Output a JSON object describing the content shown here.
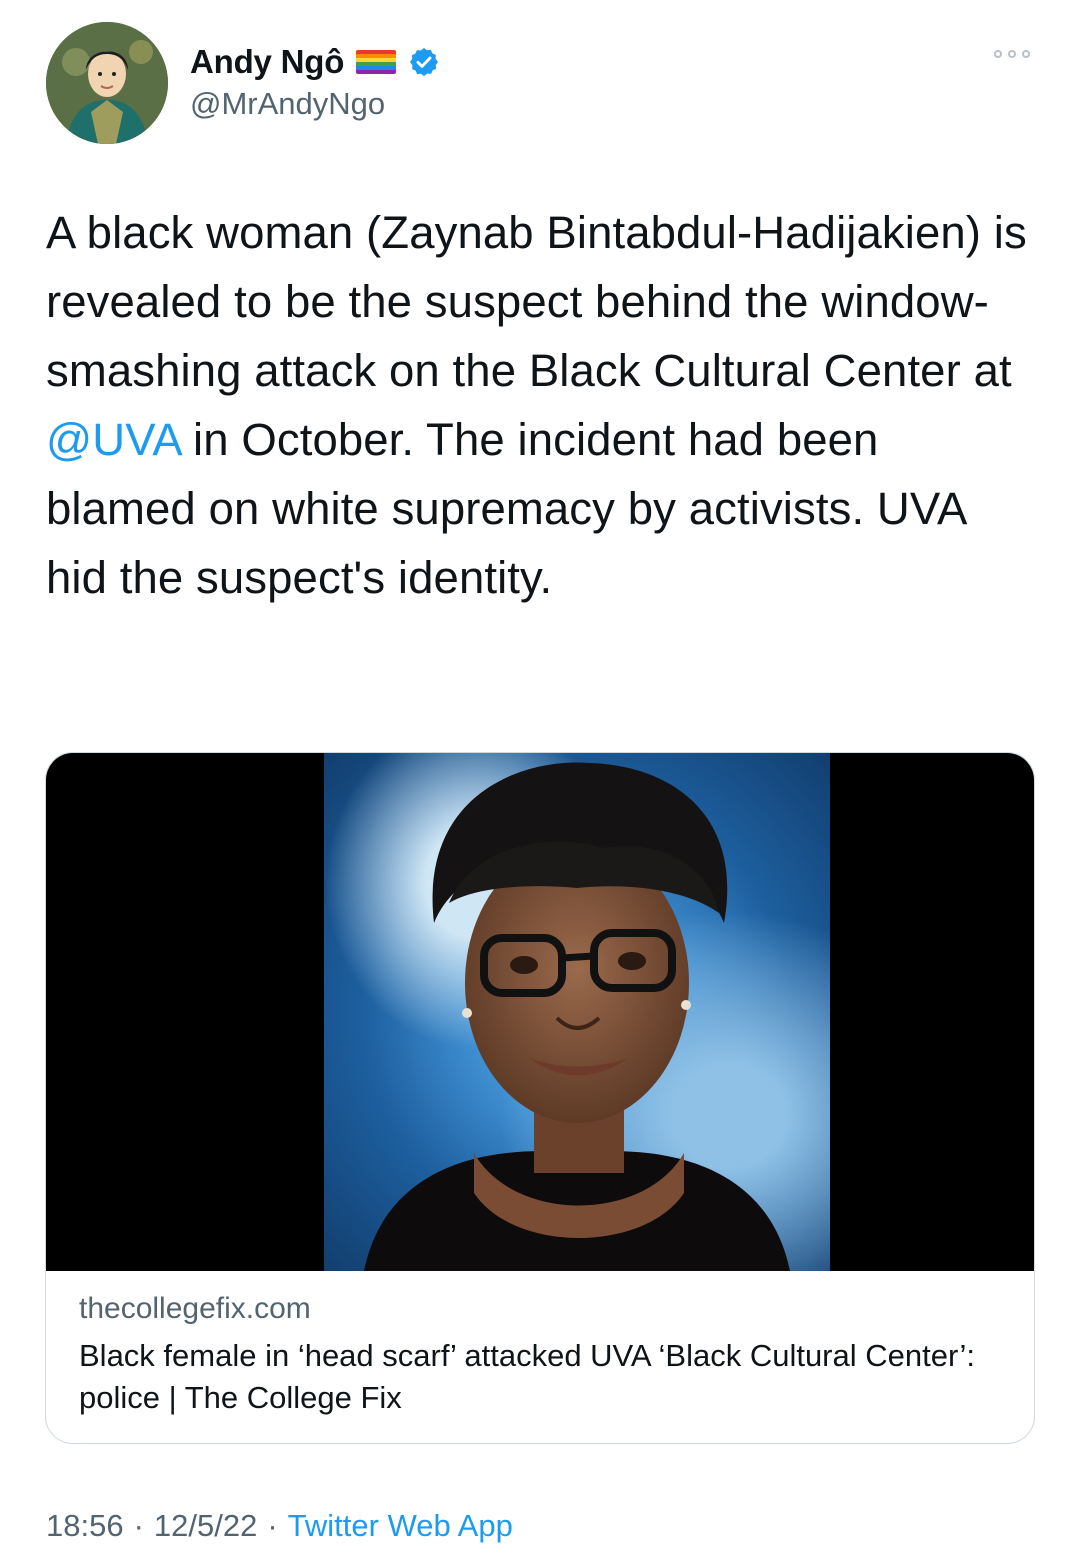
{
  "author": {
    "display_name": "Andy Ngô",
    "handle": "@MrAndyNgo",
    "badge_icon": "rainbow-flag-icon",
    "verified_icon": "verified-badge-icon"
  },
  "tweet": {
    "text_part1": "A black woman (Zaynab Bintabdul-Hadijakien) is revealed to be the suspect behind the window-smashing attack on the Black Cultural Center at ",
    "mention": "@UVA",
    "text_part2": " in October. The incident had been blamed on white supremacy by activists. UVA hid the suspect's identity."
  },
  "card": {
    "domain": "thecollegefix.com",
    "title": "Black female in ‘head scarf’ attacked UVA ‘Black Cultural Center’: police | The College Fix"
  },
  "footer": {
    "time": "18:56",
    "separator1": "·",
    "date": "12/5/22",
    "separator2": "·",
    "source": "Twitter Web App"
  },
  "colors": {
    "link_blue": "#1d9bf0",
    "secondary_text": "#536471",
    "primary_text": "#0f1419"
  }
}
